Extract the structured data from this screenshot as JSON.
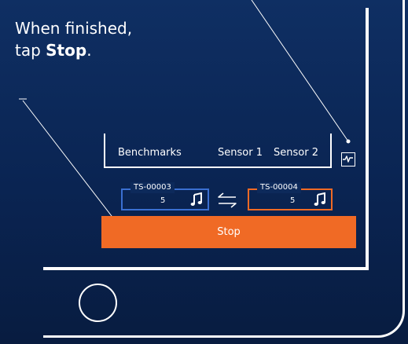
{
  "instruction": {
    "line1": "When finished,",
    "line2_prefix": "tap ",
    "line2_bold": "Stop",
    "line2_suffix": "."
  },
  "tabs": [
    {
      "label": "Benchmarks"
    },
    {
      "label": "Sensor 1"
    },
    {
      "label": "Sensor 2"
    }
  ],
  "sensors": [
    {
      "id": "TS-00003",
      "value": "5",
      "color": "#3a6fd1",
      "icon": "music-note-icon"
    },
    {
      "id": "TS-00004",
      "value": "5",
      "color": "#f06a25",
      "icon": "music-note-icon"
    }
  ],
  "stop_button": {
    "label": "Stop",
    "color": "#f06a25"
  },
  "icons": {
    "activity": "activity-icon",
    "swap": "swap-arrows-icon",
    "home": "home-button"
  }
}
